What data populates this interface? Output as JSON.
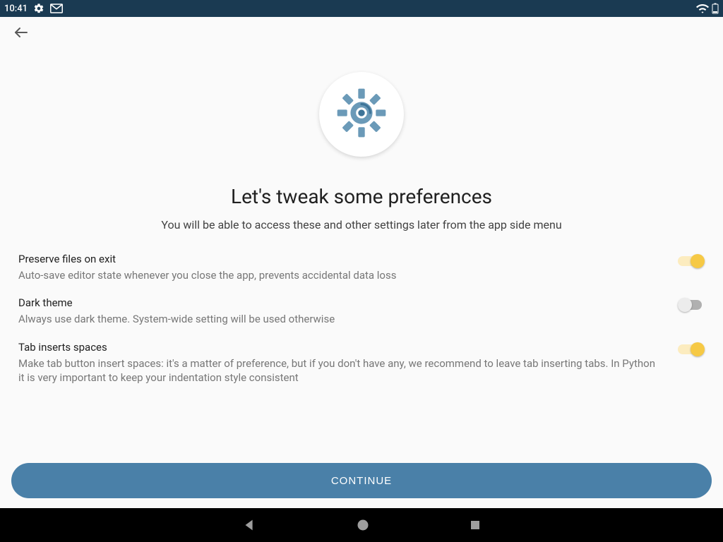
{
  "statusbar": {
    "time": "10:41"
  },
  "page": {
    "title": "Let's tweak some preferences",
    "subtitle": "You will be able to access these and other settings later from the app side menu"
  },
  "prefs": [
    {
      "title": "Preserve files on exit",
      "desc": "Auto-save editor state whenever you close the app, prevents accidental data loss",
      "on": true
    },
    {
      "title": "Dark theme",
      "desc": "Always use dark theme. System-wide setting will be used otherwise",
      "on": false
    },
    {
      "title": "Tab inserts spaces",
      "desc": "Make tab button insert spaces: it's a matter of preference, but if you don't have any, we recommend to leave tab inserting tabs. In Python it is very important to keep your indentation style consistent",
      "on": true
    }
  ],
  "actions": {
    "continue": "CONTINUE"
  }
}
